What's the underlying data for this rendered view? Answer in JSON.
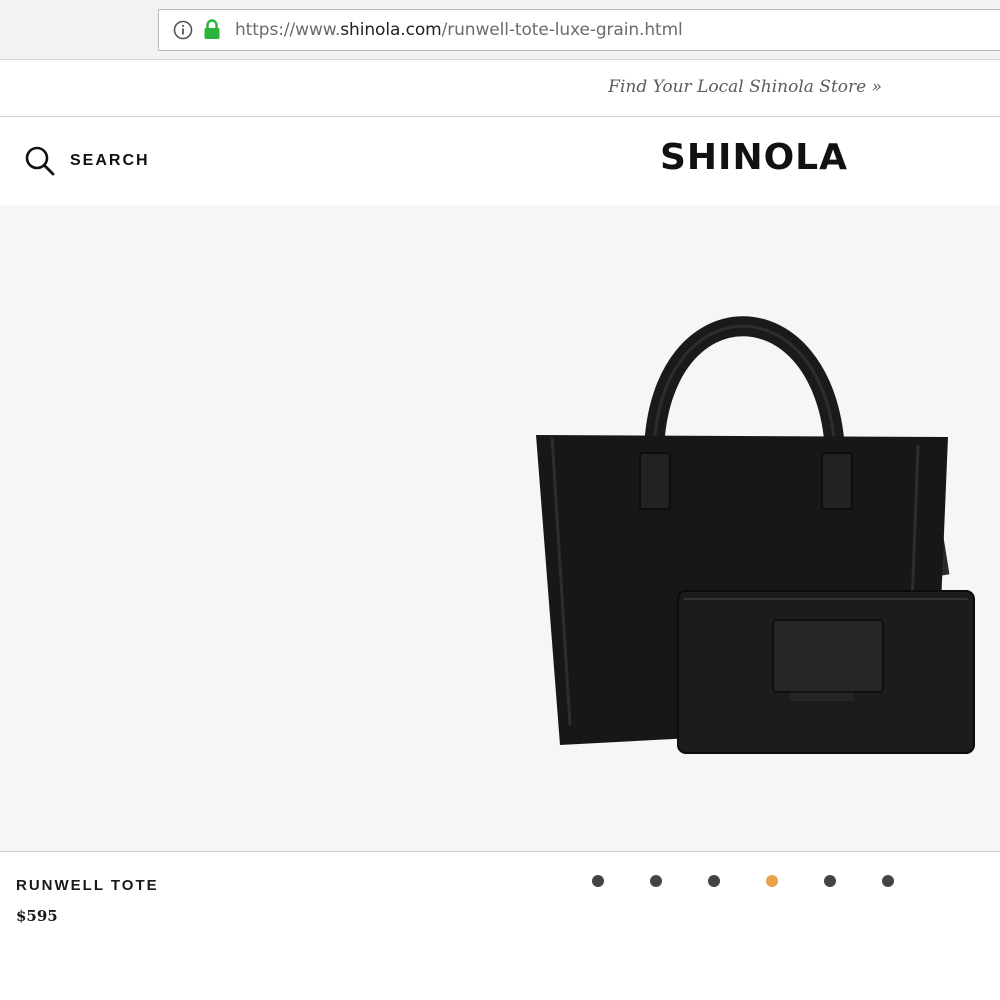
{
  "browser": {
    "url_scheme": "https://www.",
    "url_host": "shinola.com",
    "url_path": "/runwell-tote-luxe-grain.html",
    "lock_color": "#2bb43a"
  },
  "store_strip": {
    "link_text": "Find Your Local Shinola Store »"
  },
  "header": {
    "search_label": "SEARCH",
    "logo_text": "SHINOLA"
  },
  "product": {
    "name": "RUNWELL TOTE",
    "price": "$595"
  },
  "carousel": {
    "slide_count": 6,
    "active_index": 3,
    "active_color": "#e7a24a",
    "inactive_color": "#444444"
  }
}
